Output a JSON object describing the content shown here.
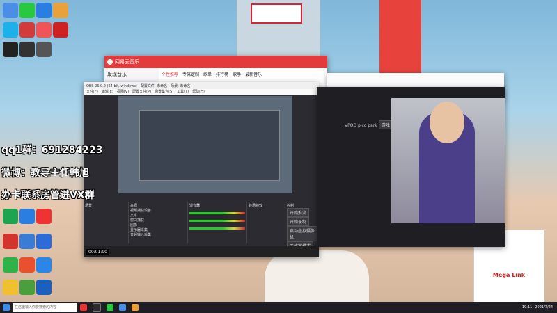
{
  "overlay": {
    "qq_group": "qq1群：691284223",
    "weibo": "微博：教导主任韩旭",
    "recruit": "办卡联系房管进VX群"
  },
  "music_app": {
    "logo": "网易云音乐",
    "tabs": [
      "个性推荐",
      "专属定制",
      "歌单",
      "排行榜",
      "歌手",
      "最新音乐"
    ],
    "sidebar_title": "发现音乐"
  },
  "obs": {
    "title": "OBS 26.0.2 (64-bit, windows) - 配置文件: 未命名 - 场景: 未命名",
    "menu": [
      "文件(F)",
      "编辑(E)",
      "视图(V)",
      "配置文件(P)",
      "场景集合(S)",
      "工具(T)",
      "帮助(H)"
    ],
    "panels": [
      "场景",
      "来源",
      "混音器",
      "转场特效",
      "控制"
    ],
    "sources": [
      "视频捕获设备",
      "文本",
      "窗口捕获",
      "图像",
      "显示器采集",
      "音频输入采集"
    ],
    "controls": [
      "开始推流",
      "开始录制",
      "启动虚拟摄像机",
      "工作室模式",
      "设置",
      "退出"
    ],
    "timecode": "00:01:00"
  },
  "camera_app": {
    "title": "VPOD pico park",
    "tag": "游戏"
  },
  "poster_text": "Mega Link",
  "taskbar": {
    "search_placeholder": "在这里输入你要搜索的内容",
    "time": "19:11",
    "date": "2021/7/24"
  },
  "colors": {
    "netease_red": "#e33b3b",
    "obs_dark": "#2b2b31",
    "taskbar": "#1e1e24"
  }
}
